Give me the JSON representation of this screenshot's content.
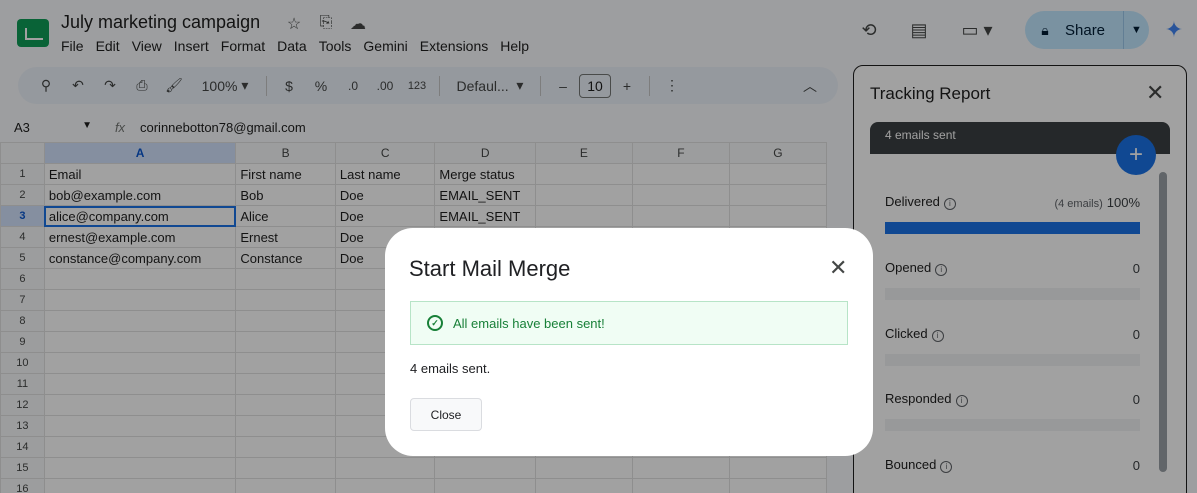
{
  "doc": {
    "title": "July marketing campaign",
    "menu": [
      "File",
      "Edit",
      "View",
      "Insert",
      "Format",
      "Data",
      "Tools",
      "Gemini",
      "Extensions",
      "Help"
    ],
    "share_label": "Share"
  },
  "toolbar": {
    "zoom": "100%",
    "currency": "$",
    "percent": "%",
    "dec_decrease": ".0",
    "dec_increase": ".00",
    "number_format": "123",
    "font": "Defaul...",
    "font_size": "10",
    "minus": "–",
    "plus": "+"
  },
  "formula_bar": {
    "cell_ref": "A3",
    "value": "corinnebotton78@gmail.com"
  },
  "sheet": {
    "columns": [
      "A",
      "B",
      "C",
      "D",
      "E",
      "F",
      "G"
    ],
    "row_numbers": [
      "1",
      "2",
      "3",
      "4",
      "5",
      "6",
      "7",
      "8",
      "9",
      "10",
      "11",
      "12",
      "13",
      "14",
      "15",
      "16"
    ],
    "rows": [
      [
        "Email",
        "First name",
        "Last name",
        "Merge status"
      ],
      [
        "bob@example.com",
        "Bob",
        "Doe",
        "EMAIL_SENT"
      ],
      [
        "alice@company.com",
        "Alice",
        "Doe",
        "EMAIL_SENT"
      ],
      [
        "ernest@example.com",
        "Ernest",
        "Doe",
        ""
      ],
      [
        "constance@company.com",
        "Constance",
        "Doe",
        ""
      ]
    ]
  },
  "panel": {
    "title": "Tracking Report",
    "banner": "4 emails sent",
    "stats": [
      {
        "name": "Delivered",
        "count": "(4 emails)",
        "value": "100%",
        "fraction": 1.0
      },
      {
        "name": "Opened",
        "count": "",
        "value": "0",
        "fraction": 0
      },
      {
        "name": "Clicked",
        "count": "",
        "value": "0",
        "fraction": 0
      },
      {
        "name": "Responded",
        "count": "",
        "value": "0",
        "fraction": 0
      },
      {
        "name": "Bounced",
        "count": "",
        "value": "0",
        "fraction": 0
      }
    ]
  },
  "dialog": {
    "title": "Start Mail Merge",
    "success_text": "All emails have been sent!",
    "message": "4 emails sent.",
    "close_label": "Close"
  },
  "colors": {
    "accent": "#1a73e8",
    "success": "#188038",
    "share_bg": "#c2e7ff"
  }
}
